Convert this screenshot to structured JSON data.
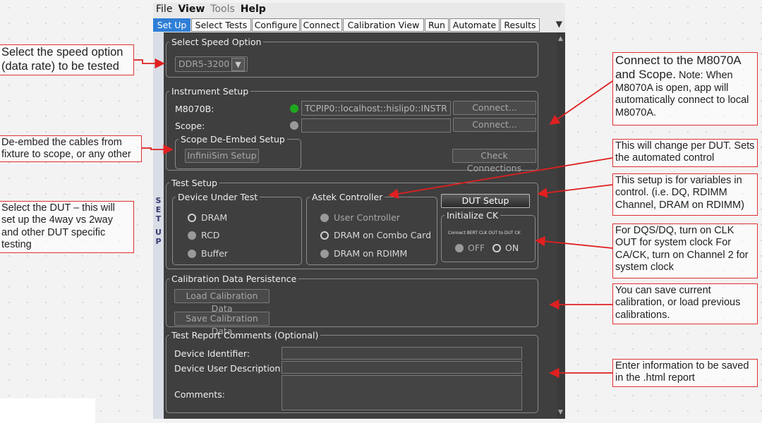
{
  "menu": [
    "File",
    "View",
    "Tools",
    "Help"
  ],
  "tabs": [
    "Set Up",
    "Select Tests",
    "Configure",
    "Connect",
    "Calibration View",
    "Run",
    "Automate",
    "Results"
  ],
  "overflow_icon": "chevron-down-icon",
  "side_label": [
    "S",
    "E",
    "T",
    "",
    "U",
    "P"
  ],
  "speed": {
    "legend": "Select Speed Option",
    "value": "DDR5-3200"
  },
  "instrument": {
    "legend": "Instrument Setup",
    "m8070b_label": "M8070B:",
    "m8070b_address": "TCPIP0::localhost::hislip0::INSTR",
    "m8070b_status_color": "#1fa81f",
    "scope_label": "Scope:",
    "scope_address": "",
    "scope_status_color": "#9a9a9a",
    "connect_label": "Connect...",
    "deembed_legend": "Scope De-Embed Setup",
    "infiniisim_label": "InfiniiSim Setup",
    "check_label": "Check Connections"
  },
  "test": {
    "legend": "Test Setup",
    "dut_legend": "Device Under Test",
    "dut_options": [
      "DRAM",
      "RCD",
      "Buffer"
    ],
    "dut_selected": "DRAM",
    "astek_legend": "Astek Controller",
    "astek_options": [
      "User Controller",
      "DRAM on Combo Card",
      "DRAM on RDIMM"
    ],
    "astek_selected": "DRAM on Combo Card",
    "dut_setup_label": "DUT Setup",
    "ck_legend": "Initialize CK",
    "ck_note": "Connect BERT CLK OUT to DUT CK",
    "ck_options": [
      "OFF",
      "ON"
    ],
    "ck_selected": "ON"
  },
  "calibration": {
    "legend": "Calibration Data Persistence",
    "load_label": "Load Calibration Data",
    "save_label": "Save Calibration Data"
  },
  "report": {
    "legend": "Test Report Comments (Optional)",
    "identifier_label": "Device Identifier:",
    "description_label": "Device User Description:",
    "comments_label": "Comments:",
    "identifier_value": "",
    "description_value": "",
    "comments_value": ""
  },
  "annotations": {
    "speed": "Select the speed option (data rate) to be tested",
    "deembed": "De-embed the cables from fixture to scope, or any other",
    "dut": "Select the DUT – this will set up the 4way vs 2way and other DUT specific testing",
    "connect_main": "Connect to the M8070A and Scope.",
    "connect_note": " Note: When M8070A is open, app will automatically connect to local M8070A.",
    "per_dut": "This will change per DUT. Sets the automated control",
    "variables": "This setup is for variables in control. (i.e. DQ, RDIMM Channel, DRAM on RDIMM)",
    "clock": "For DQS/DQ, turn on CLK OUT for system clock For CA/CK, turn on Channel 2 for system clock",
    "calib": "You can save current calibration, or load previous calibrations.",
    "report": "Enter information to be saved in the .html report"
  },
  "colors": {
    "accent": "#2f7fd6",
    "arrow": "#e02020"
  }
}
